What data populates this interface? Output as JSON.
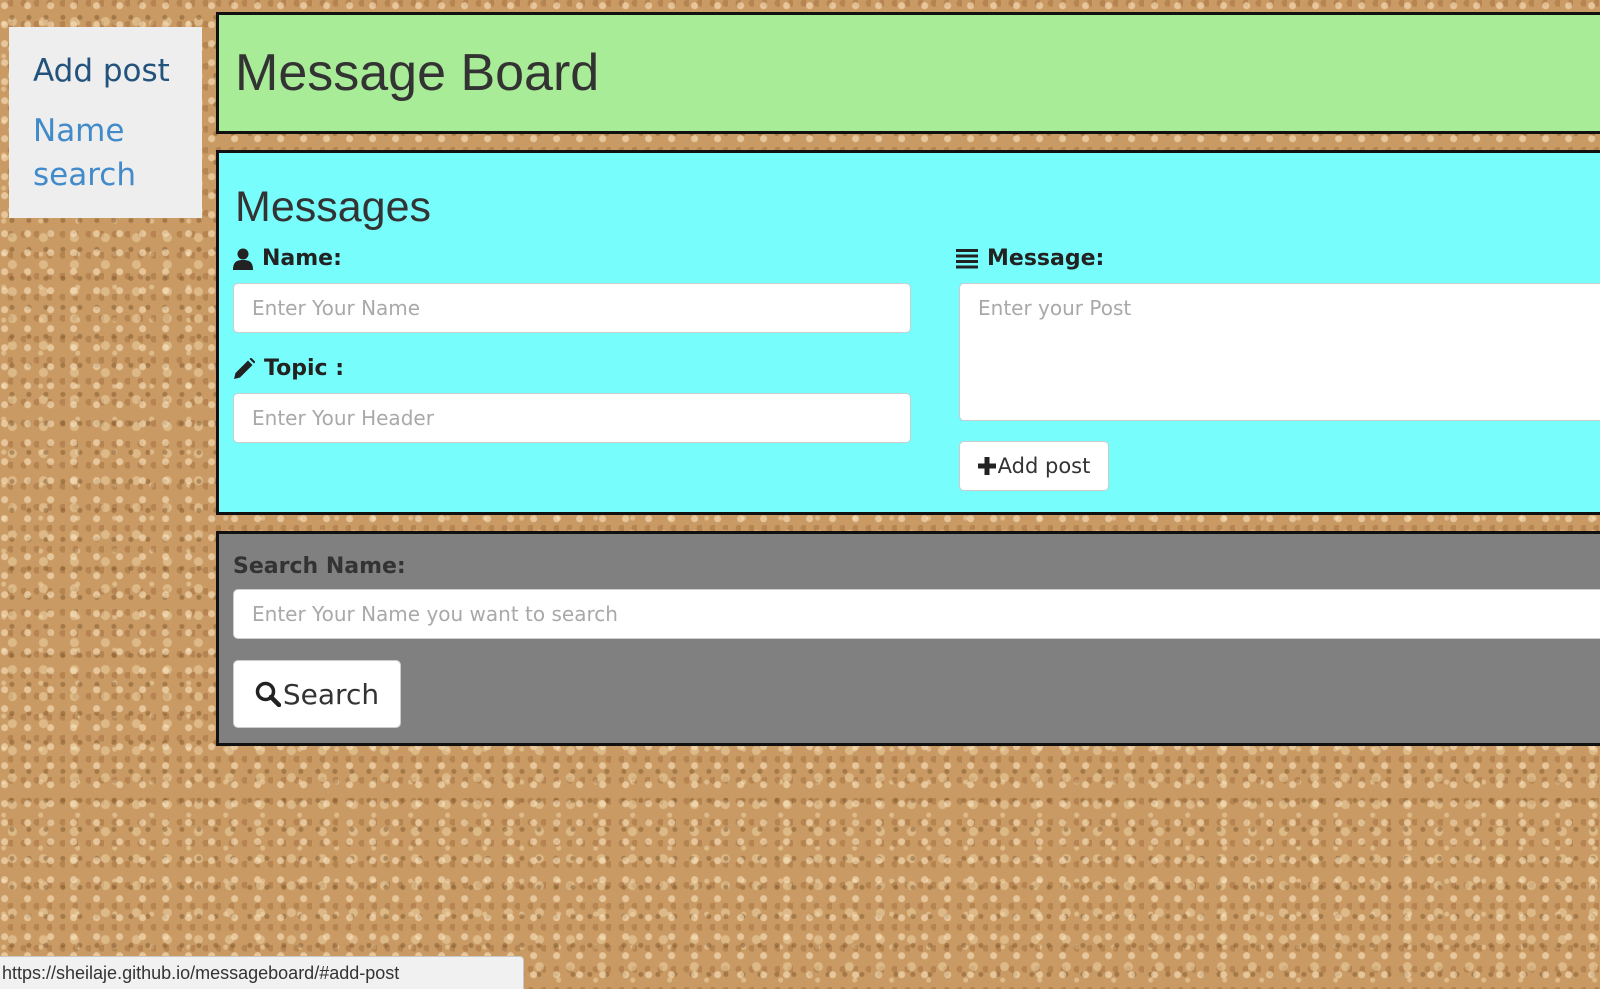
{
  "nav": {
    "items": [
      {
        "label": "Add post"
      },
      {
        "label": "Name search"
      }
    ]
  },
  "header": {
    "title": "Message Board"
  },
  "messages": {
    "title": "Messages",
    "name_label": "Name:",
    "name_placeholder": "Enter Your Name",
    "topic_label": "Topic :",
    "topic_placeholder": "Enter Your Header",
    "message_label": "Message:",
    "message_placeholder": "Enter your Post",
    "add_button_label": "Add post",
    "icons": {
      "name": "user-icon",
      "topic": "pencil-icon",
      "message": "list-icon",
      "add": "plus-icon"
    }
  },
  "search": {
    "label": "Search Name:",
    "placeholder": "Enter Your Name you want to search",
    "button_label": "Search",
    "icon": "search-icon"
  },
  "status_bar": {
    "url": "https://sheilaje.github.io/messageboard/#add-post"
  },
  "colors": {
    "header_bg": "#a8ec98",
    "messages_bg": "#78fdfd",
    "search_bg": "#808080",
    "sidebar_bg": "#eeeeee",
    "nav_active": "#23527c",
    "nav_link": "#428bca"
  }
}
